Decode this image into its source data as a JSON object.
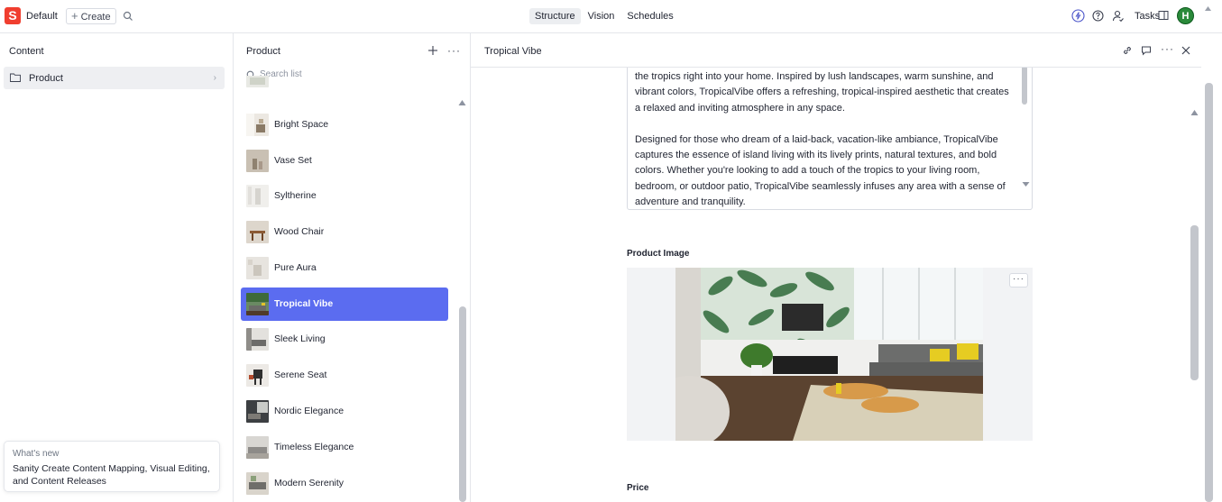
{
  "topbar": {
    "workspace": "Default",
    "create_label": "Create",
    "nav": [
      "Structure",
      "Vision",
      "Schedules"
    ],
    "active_nav": "Structure",
    "tasks_label": "Tasks",
    "avatar_initial": "H",
    "logo_letter": "S",
    "brand_color": "#f03e2f"
  },
  "content_pane": {
    "title": "Content",
    "items": [
      {
        "label": "Product"
      }
    ]
  },
  "whats_new": {
    "heading": "What's new",
    "body": "Sanity Create Content Mapping, Visual Editing, and Content Releases"
  },
  "product_pane": {
    "title": "Product",
    "search_placeholder": "Search list",
    "items": [
      {
        "label": "Bright Space"
      },
      {
        "label": "Vase Set"
      },
      {
        "label": "Syltherine"
      },
      {
        "label": "Wood Chair"
      },
      {
        "label": "Pure Aura"
      },
      {
        "label": "Tropical Vibe"
      },
      {
        "label": "Sleek Living"
      },
      {
        "label": "Serene Seat"
      },
      {
        "label": "Nordic Elegance"
      },
      {
        "label": "Timeless Elegance"
      },
      {
        "label": "Modern Serenity"
      }
    ],
    "selected": "Tropical Vibe",
    "selected_color": "#5b6cf0"
  },
  "document": {
    "title": "Tropical Vibe",
    "description_paragraphs": [
      "the tropics right into your home. Inspired by lush landscapes, warm sunshine, and vibrant colors, TropicalVibe offers a refreshing, tropical-inspired aesthetic that creates a relaxed and inviting atmosphere in any space.",
      "Designed for those who dream of a laid-back, vacation-like ambiance, TropicalVibe captures the essence of island living with its lively prints, natural textures, and bold colors. Whether you're looking to add a touch of the tropics to your living room, bedroom, or outdoor patio, TropicalVibe seamlessly infuses any area with a sense of adventure and tranquility."
    ],
    "product_image_label": "Product Image",
    "price_label": "Price"
  }
}
